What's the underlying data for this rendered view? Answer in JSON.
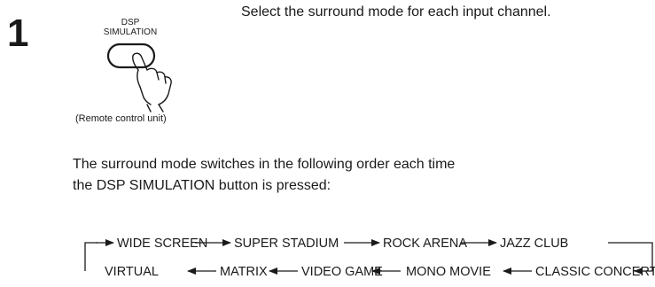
{
  "step": {
    "number": "1",
    "instruction": "Select the surround mode for each input channel."
  },
  "remote": {
    "button_label_line1": "DSP",
    "button_label_line2": "SIMULATION",
    "caption": "(Remote control unit)"
  },
  "description": {
    "line1": "The surround mode switches in the following order each time",
    "line2": "the DSP SIMULATION button is pressed:"
  },
  "mode_sequence": {
    "top_row": [
      "WIDE SCREEN",
      "SUPER STADIUM",
      "ROCK ARENA",
      "JAZZ CLUB"
    ],
    "bottom_row": [
      "VIRTUAL",
      "MATRIX",
      "VIDEO GAME",
      "MONO MOVIE",
      "CLASSIC CONCERT"
    ]
  }
}
